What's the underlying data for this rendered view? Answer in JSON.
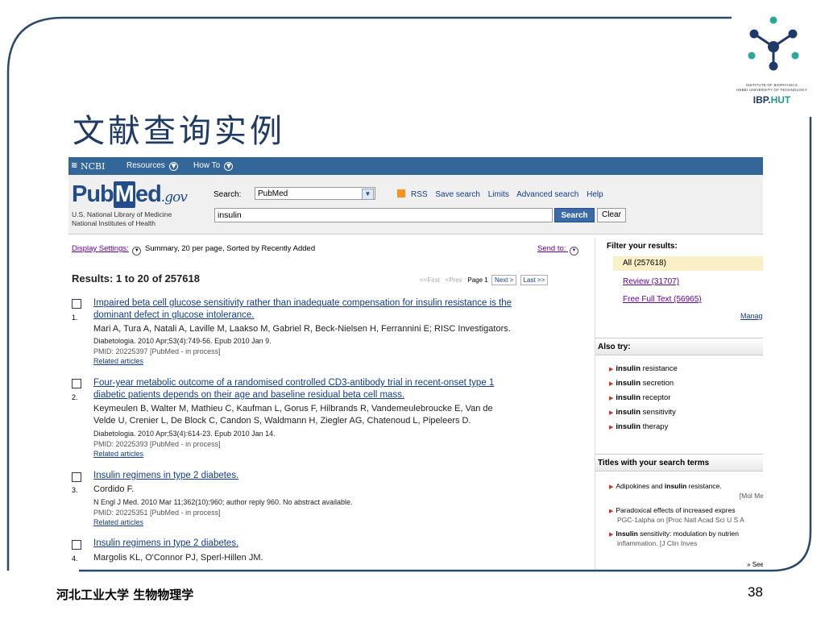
{
  "slide": {
    "title": "文献查询实例",
    "footer_left": "河北工业大学  生物物理学",
    "page_number": "38",
    "logo_line1": "INSTITUTE OF BIOPHYSICS",
    "logo_line2": "HEBEI UNIVERSITY OF TECHNOLOGY",
    "logo_brand_a": "IBP.",
    "logo_brand_b": "HUT",
    "colors": {
      "title": "#1f3b64",
      "logo_node": "#2aa898",
      "logo_hub": "#1d3a6b"
    }
  },
  "ncbi": {
    "brand": "NCBI",
    "resources": "Resources",
    "howto": "How To"
  },
  "pubmed": {
    "logo_pub": "Pub",
    "logo_m": "M",
    "logo_ed": "ed",
    "logo_gov": ".gov",
    "sub1": "U.S. National Library of Medicine",
    "sub2": "National Institutes of Health",
    "search_label": "Search:",
    "db_value": "PubMed",
    "query": "insulin",
    "links": {
      "rss": "RSS",
      "save": "Save search",
      "limits": "Limits",
      "advanced": "Advanced search",
      "help": "Help"
    },
    "search_button": "Search",
    "clear_button": "Clear"
  },
  "results": {
    "display_settings": "Display Settings:",
    "settings_text": "Summary, 20 per page, Sorted by Recently Added",
    "send_to": "Send to:",
    "count": "Results: 1 to 20 of 257618",
    "pager": {
      "first": "<<First",
      "prev": "<Prev",
      "page": "Page 1",
      "next": "Next >",
      "last": "Last >>"
    },
    "items": [
      {
        "num": "1.",
        "title_l1": "Impaired beta cell glucose sensitivity rather than inadequate compensation for insulin resistance is the",
        "title_l2": "dominant defect in glucose intolerance.",
        "authors_l1": "Mari A, Tura A, Natali A, Laville M, Laakso M, Gabriel R, Beck-Nielsen H, Ferrannini E; RISC Investigators.",
        "authors_l2": "",
        "journal": "Diabetologia. 2010 Apr;53(4):749-56. Epub 2010 Jan 9.",
        "pmid": "PMID: 20225397 [PubMed - in process]",
        "related": "Related articles"
      },
      {
        "num": "2.",
        "title_l1": "Four-year metabolic outcome of a randomised controlled CD3-antibody trial in recent-onset type 1",
        "title_l2": "diabetic patients depends on their age and baseline residual beta cell mass.",
        "authors_l1": "Keymeulen B, Walter M, Mathieu C, Kaufman L, Gorus F, Hilbrands R, Vandemeulebroucke E, Van de",
        "authors_l2": "Velde U, Crenier L, De Block C, Candon S, Waldmann H, Ziegler AG, Chatenoud L, Pipeleers D.",
        "journal": "Diabetologia. 2010 Apr;53(4):614-23. Epub 2010 Jan 14.",
        "pmid": "PMID: 20225393 [PubMed - in process]",
        "related": "Related articles"
      },
      {
        "num": "3.",
        "title_l1": "Insulin regimens in type 2 diabetes.",
        "title_l2": "",
        "authors_l1": "Cordido F.",
        "authors_l2": "",
        "journal": "N Engl J Med. 2010 Mar 11;362(10):960; author reply 960. No abstract available.",
        "pmid": "PMID: 20225351 [PubMed - in process]",
        "related": "Related articles"
      },
      {
        "num": "4.",
        "title_l1": "Insulin regimens in type 2 diabetes.",
        "title_l2": "",
        "authors_l1": "Margolis KL, O'Connor PJ, Sperl-Hillen JM.",
        "authors_l2": "",
        "journal": "",
        "pmid": "",
        "related": ""
      }
    ]
  },
  "sidebar": {
    "filter_head": "Filter your results:",
    "filter_all": "All (257618)",
    "filter_review": "Review (31707)",
    "filter_free": "Free Full Text (56965)",
    "manage": "Manag",
    "also_head": "Also try:",
    "also": [
      {
        "b": "insulin",
        "t": " resistance"
      },
      {
        "b": "insulin",
        "t": " secretion"
      },
      {
        "b": "insulin",
        "t": " receptor"
      },
      {
        "b": "insulin",
        "t": " sensitivity"
      },
      {
        "b": "insulin",
        "t": " therapy"
      }
    ],
    "titles_head": "Titles with your search terms",
    "titles": [
      {
        "l1a": "Adipokines and ",
        "l1b": "insulin",
        "l1c": " resistance.",
        "l2": "[Mol Me"
      },
      {
        "l1a": "Paradoxical effects of increased expres",
        "l1b": "",
        "l1c": "",
        "l2": "PGC-1alpha on [Proc Natl Acad Sci U S A"
      },
      {
        "l1a": "",
        "l1b": "Insulin",
        "l1c": " sensitivity: modulation by nutrien",
        "l2": "inflammation.                    [J Clin Inves"
      }
    ],
    "see_more": "» See"
  }
}
